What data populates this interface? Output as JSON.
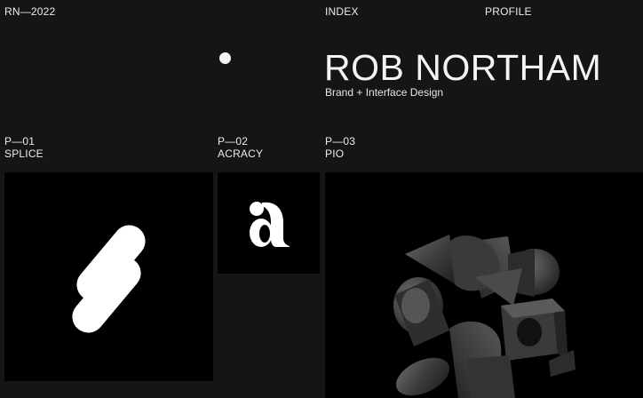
{
  "header": {
    "code": "RN—2022",
    "nav": {
      "index": "INDEX",
      "profile": "PROFILE"
    }
  },
  "hero": {
    "name": "ROB NORTHAM",
    "tagline": "Brand + Interface Design"
  },
  "projects": [
    {
      "number": "P—01",
      "title": "SPLICE",
      "thumb_icon": "splice-logo-icon"
    },
    {
      "number": "P—02",
      "title": "ACRACY",
      "thumb_icon": "acracy-a-logo-icon",
      "logo_text": "a"
    },
    {
      "number": "P—03",
      "title": "PIO",
      "thumb_icon": "3d-shapes-render"
    }
  ],
  "colors": {
    "background": "#151515",
    "card": "#000000",
    "text": "#ececec"
  }
}
